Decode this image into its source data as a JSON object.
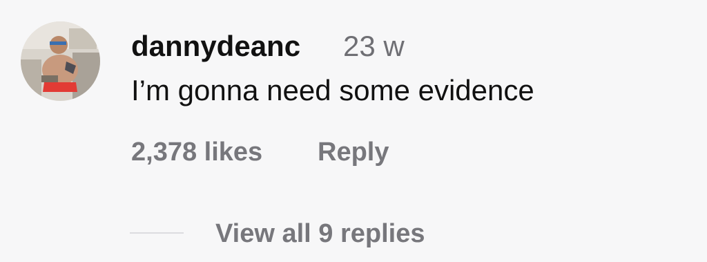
{
  "comment": {
    "username": "dannydeanc",
    "timestamp": "23 w",
    "text": "I’m gonna need some evidence",
    "likes": "2,378 likes",
    "reply_label": "Reply",
    "view_replies_label": "View all 9 replies"
  }
}
